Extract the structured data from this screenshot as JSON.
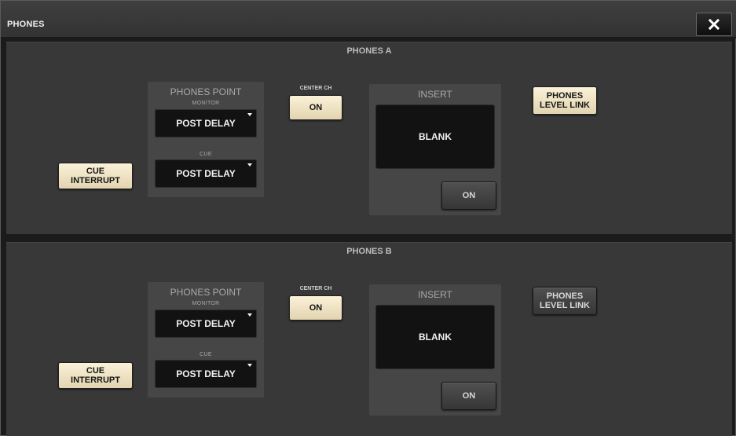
{
  "window": {
    "title": "PHONES",
    "close_glyph": "✕"
  },
  "colors": {
    "button_on": "#f4ead0",
    "button_off": "#444444",
    "panel_bg": "#383838",
    "group_bg": "#464646",
    "display_bg": "#121212"
  },
  "sections": [
    {
      "title": "PHONES A",
      "cue_interrupt": {
        "line1": "CUE",
        "line2": "INTERRUPT",
        "state": "on"
      },
      "phones_point": {
        "title": "PHONES POINT",
        "monitor_label": "MONITOR",
        "monitor_value": "POST DELAY",
        "cue_label": "CUE",
        "cue_value": "POST DELAY"
      },
      "center_ch": {
        "label": "CENTER CH",
        "button": "ON",
        "state": "on"
      },
      "insert": {
        "title": "INSERT",
        "display": "BLANK",
        "button": "ON",
        "state": "off"
      },
      "level_link": {
        "line1": "PHONES",
        "line2": "LEVEL LINK",
        "state": "on"
      }
    },
    {
      "title": "PHONES B",
      "cue_interrupt": {
        "line1": "CUE",
        "line2": "INTERRUPT",
        "state": "on"
      },
      "phones_point": {
        "title": "PHONES POINT",
        "monitor_label": "MONITOR",
        "monitor_value": "POST DELAY",
        "cue_label": "CUE",
        "cue_value": "POST DELAY"
      },
      "center_ch": {
        "label": "CENTER CH",
        "button": "ON",
        "state": "on"
      },
      "insert": {
        "title": "INSERT",
        "display": "BLANK",
        "button": "ON",
        "state": "off"
      },
      "level_link": {
        "line1": "PHONES",
        "line2": "LEVEL LINK",
        "state": "off"
      }
    }
  ]
}
